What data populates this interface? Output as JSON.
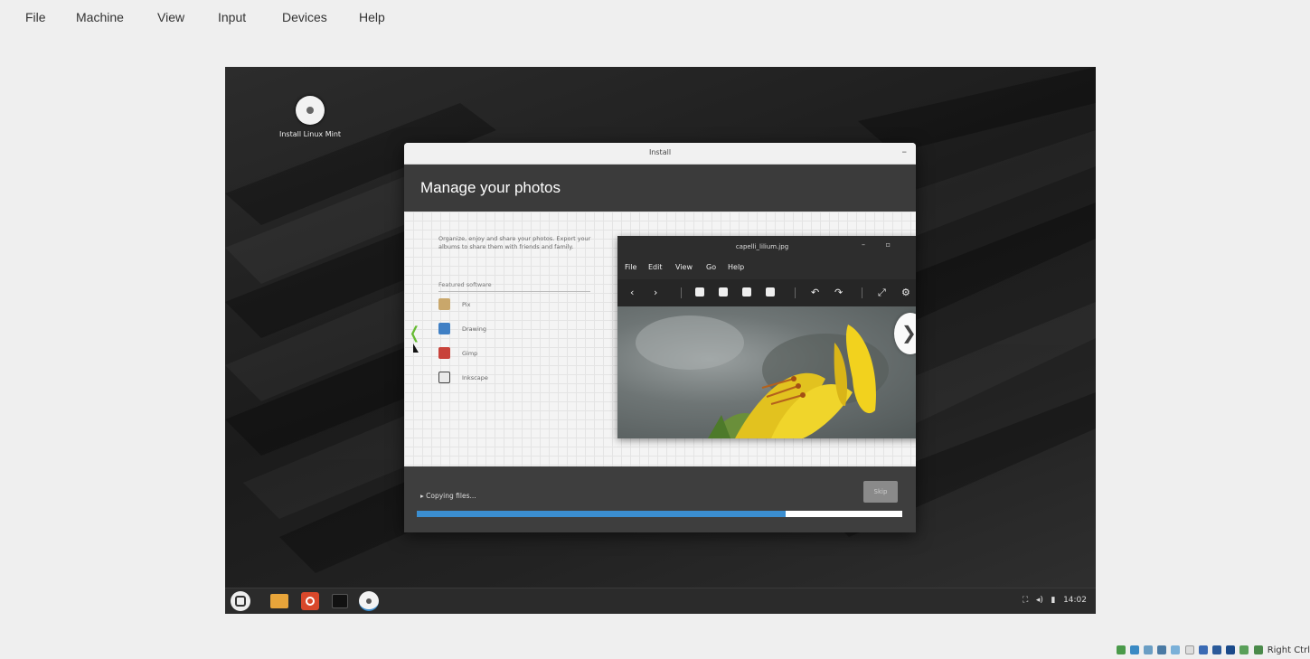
{
  "host_menu": [
    "File",
    "Machine",
    "View",
    "Input",
    "Devices",
    "Help"
  ],
  "desktop": {
    "icon_label": "Install Linux Mint"
  },
  "installer": {
    "window_title": "Install",
    "minimize_glyph": "–",
    "heading": "Manage your photos",
    "description": "Organize, enjoy and share your photos. Export your albums to share them with friends and family.",
    "featured_label": "Featured software",
    "apps": [
      {
        "name": "Pix",
        "icon": "pix-icon",
        "color": "#c9a76b"
      },
      {
        "name": "Drawing",
        "icon": "drawing-icon",
        "color": "#3f7fc4"
      },
      {
        "name": "Gimp",
        "icon": "gimp-icon",
        "color": "#c8423a"
      },
      {
        "name": "Inkscape",
        "icon": "inkscape-icon",
        "color": "#444444"
      }
    ],
    "prev_glyph": "❬",
    "next_glyph": "❯",
    "status_text": "▸ Copying files...",
    "skip_label": "Skip",
    "progress": 0.76,
    "accent": "#3b8ed0"
  },
  "viewer": {
    "title": "capelli_lilium.jpg",
    "window_controls": "– ▫",
    "menu": [
      "File",
      "Edit",
      "View",
      "Go",
      "Help"
    ],
    "prev": "‹",
    "next": "›",
    "rotate_left": "↶",
    "rotate_right": "↷",
    "fullscreen": "⤢",
    "settings": "⚙"
  },
  "taskbar": {
    "clock": "14:02",
    "network_glyph": "⛶",
    "volume_glyph": "◂)",
    "battery_glyph": "▮"
  },
  "host_status": {
    "key_label": "Right Ctrl"
  }
}
